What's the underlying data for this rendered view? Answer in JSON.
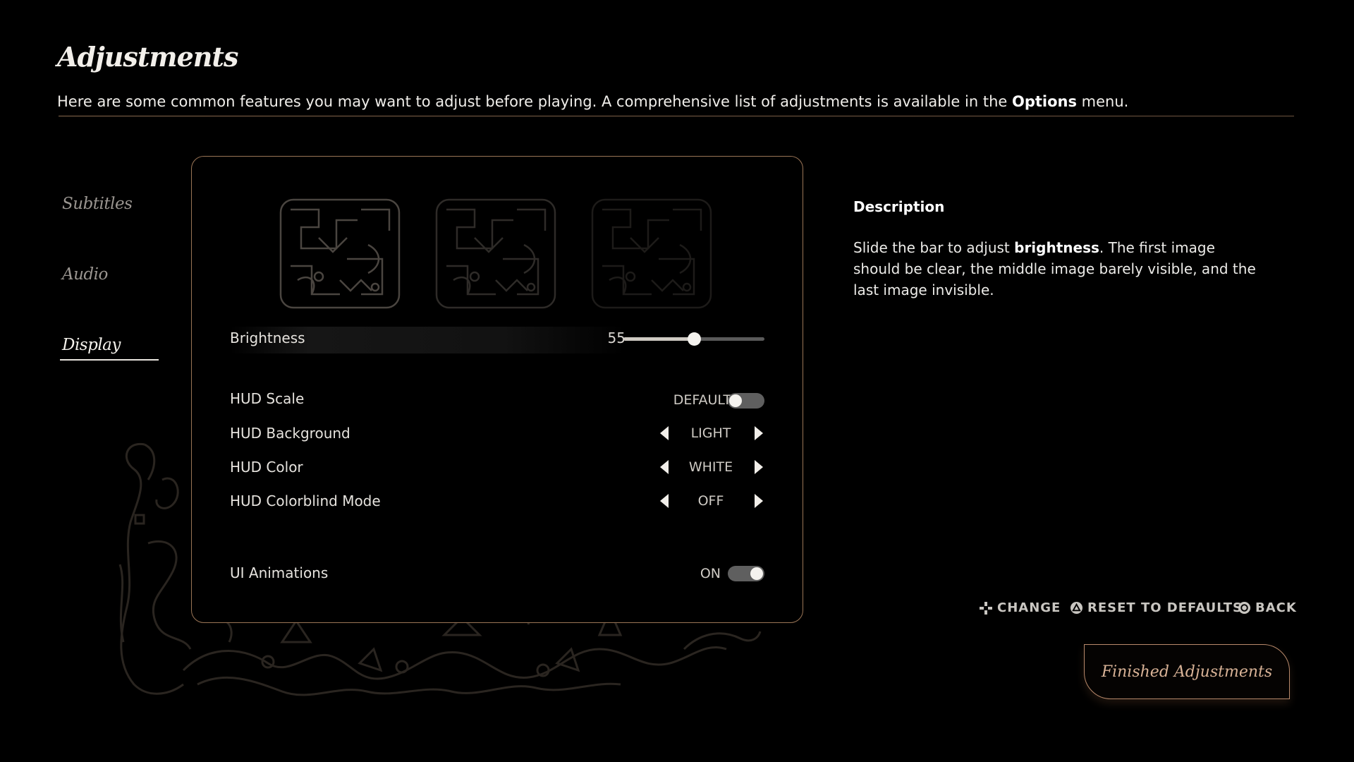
{
  "header": {
    "title": "Adjustments",
    "subtitle_pre": "Here are some common features you may want to adjust before playing. A comprehensive list of adjustments is available in the ",
    "subtitle_bold": "Options",
    "subtitle_post": " menu."
  },
  "sidebar": {
    "items": [
      {
        "label": "Subtitles",
        "active": false
      },
      {
        "label": "Audio",
        "active": false
      },
      {
        "label": "Display",
        "active": true
      }
    ]
  },
  "settings": {
    "brightness": {
      "label": "Brightness",
      "value": "55",
      "percent": 50
    },
    "hud_scale": {
      "label": "HUD Scale",
      "value": "DEFAULT",
      "toggle_on": false
    },
    "hud_background": {
      "label": "HUD Background",
      "value": "LIGHT"
    },
    "hud_color": {
      "label": "HUD Color",
      "value": "WHITE"
    },
    "hud_colorblind": {
      "label": "HUD Colorblind Mode",
      "value": "OFF"
    },
    "ui_animations": {
      "label": "UI Animations",
      "value": "ON",
      "toggle_on": true
    }
  },
  "description": {
    "heading": "Description",
    "pre": "Slide the bar to adjust ",
    "bold": "brightness",
    "post": ". The first image should be clear, the middle image barely visible, and the last image invisible."
  },
  "hints": {
    "change": "CHANGE",
    "reset": "RESET TO DEFAULTS",
    "back": "BACK"
  },
  "finish_button": "Finished Adjustments",
  "colors": {
    "accent_border": "#9a7556",
    "button_text": "#d8b296",
    "background": "#000000"
  }
}
